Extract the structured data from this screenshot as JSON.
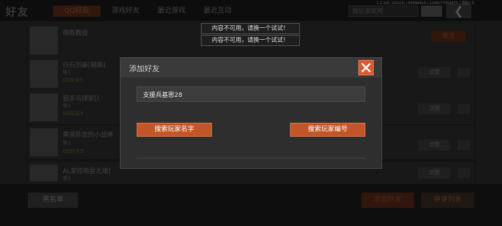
{
  "status_bar": "1.2.165.1052(3) | 65896910 | 1239177456875 | 国服1-5",
  "header": {
    "title": "好友",
    "tabs": [
      {
        "label": "QQ好友",
        "active": true
      },
      {
        "label": "游戏好友",
        "active": false
      },
      {
        "label": "最近游戏",
        "active": false
      },
      {
        "label": "最近互动",
        "active": false
      }
    ],
    "search_placeholder": "搜玩家昵称"
  },
  "friends": [
    {
      "name": "德胜教授",
      "sub": "",
      "tag": "",
      "action": "邀请"
    },
    {
      "name": "白石剑豪[朝族]",
      "sub": "等1",
      "tag": "QQ好友5",
      "action": "点赞"
    },
    {
      "name": "狙杀马球家[]",
      "sub": "等1",
      "tag": "QQ好友5",
      "action": "点赞"
    },
    {
      "name": "黄泉卧龙的小战神",
      "sub": "等3",
      "tag": "QQ好友5",
      "action": "点赞"
    },
    {
      "name": "AL掌控雨星北端]",
      "sub": "等3",
      "tag": "",
      "action": "点赞"
    }
  ],
  "footer": {
    "blacklist": "黑名单",
    "add_friend": "添加好友",
    "apply_list": "申请列表"
  },
  "toasts": [
    "内容不可用，请换一个试试！",
    "内容不可用，请换一个试试！"
  ],
  "dialog": {
    "title": "添加好友",
    "input_value": "支援兵基恩28",
    "search_by_name": "搜索玩家名字",
    "search_by_id": "搜索玩家编号"
  },
  "colors": {
    "accent": "#c25628",
    "close": "#d85a30"
  }
}
